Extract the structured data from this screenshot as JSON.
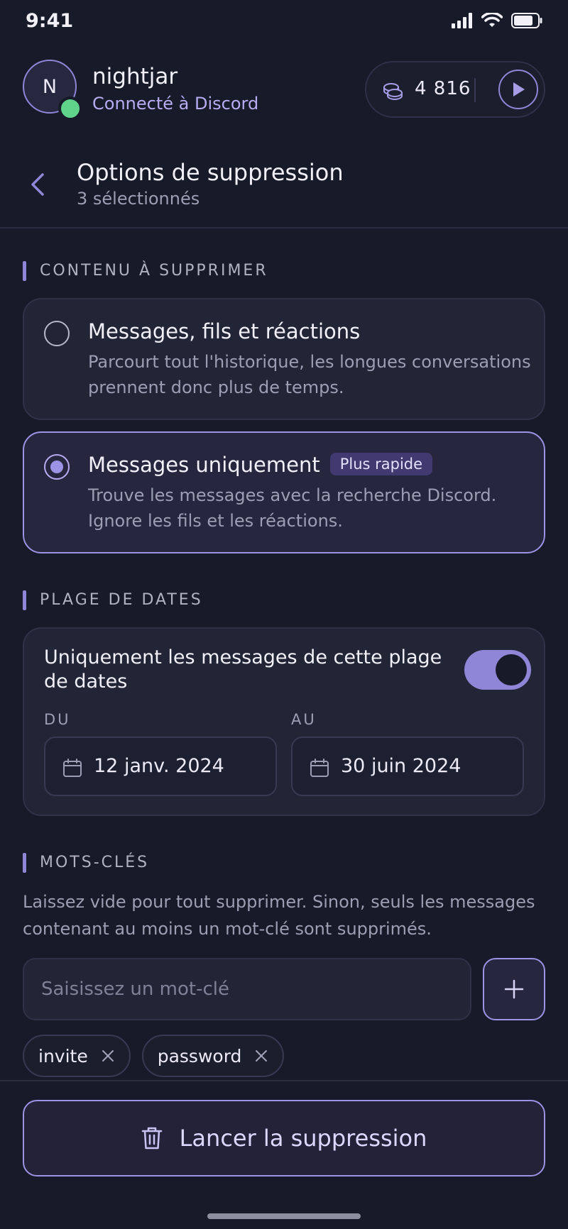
{
  "status_bar": {
    "time": "9:41"
  },
  "user": {
    "initial": "N",
    "name": "nightjar",
    "status": "Connecté à Discord"
  },
  "coins": {
    "value": "4 816"
  },
  "page": {
    "title": "Options de suppression",
    "subtitle": "3 sélectionnés"
  },
  "content_section": {
    "label": "CONTENU À SUPPRIMER",
    "options": [
      {
        "title": "Messages, fils et réactions",
        "description": "Parcourt tout l'historique, les longues conversations prennent donc plus de temps.",
        "selected": false
      },
      {
        "title": "Messages uniquement",
        "badge": "Plus rapide",
        "description": "Trouve les messages avec la recherche Discord. Ignore les fils et les réactions.",
        "selected": true
      }
    ]
  },
  "date_section": {
    "label": "PLAGE DE DATES",
    "toggle_label": "Uniquement les messages de cette plage de dates",
    "toggle_on": true,
    "from_label": "DU",
    "from_value": "12 janv. 2024",
    "to_label": "AU",
    "to_value": "30 juin 2024"
  },
  "keywords_section": {
    "label": "MOTS-CLÉS",
    "help": "Laissez vide pour tout supprimer. Sinon, seuls les messages contenant au moins un mot-clé sont supprimés.",
    "input_placeholder": "Saisissez un mot-clé",
    "input_value": "",
    "chips": [
      "invite",
      "password"
    ]
  },
  "footer": {
    "start_label": "Lancer la suppression"
  },
  "colors": {
    "accent": "#9d93e4",
    "online": "#5fd38a",
    "background": "#171a28"
  }
}
